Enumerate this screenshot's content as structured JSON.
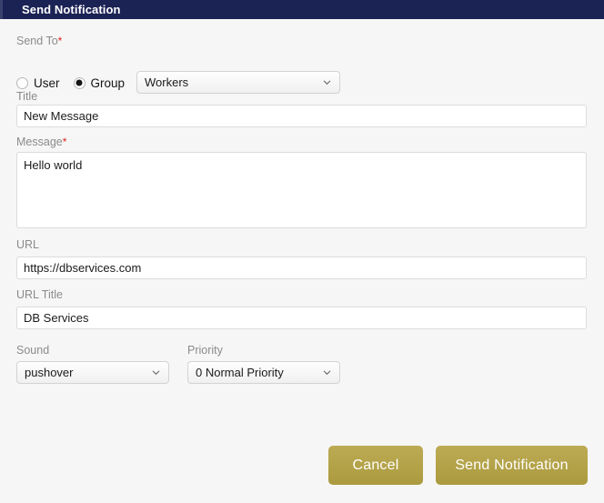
{
  "titlebar": {
    "title": "Send Notification"
  },
  "form": {
    "send_to": {
      "label": "Send To",
      "required_mark": "*",
      "options": [
        {
          "label": "User",
          "selected": false
        },
        {
          "label": "Group",
          "selected": true
        }
      ],
      "group_select": {
        "value": "Workers",
        "icon": "chevron-down-icon"
      }
    },
    "title_field": {
      "label": "Title",
      "value": "New Message",
      "placeholder": ""
    },
    "message_field": {
      "label": "Message",
      "required_mark": "*",
      "value": "Hello world",
      "placeholder": ""
    },
    "url_field": {
      "label": "URL",
      "value": "https://dbservices.com",
      "placeholder": ""
    },
    "url_title_field": {
      "label": "URL Title",
      "value": "DB Services",
      "placeholder": ""
    },
    "sound_field": {
      "label": "Sound",
      "value": "pushover",
      "icon": "chevron-down-icon"
    },
    "priority_field": {
      "label": "Priority",
      "value": "0 Normal Priority",
      "icon": "chevron-down-icon"
    }
  },
  "actions": {
    "cancel_label": "Cancel",
    "submit_label": "Send Notification"
  },
  "colors": {
    "titlebar_bg": "#1b2254",
    "button_gold": "#b4a349",
    "required_red": "#e02020",
    "label_gray": "#8b8b8b",
    "page_bg": "#f6f6f6"
  }
}
